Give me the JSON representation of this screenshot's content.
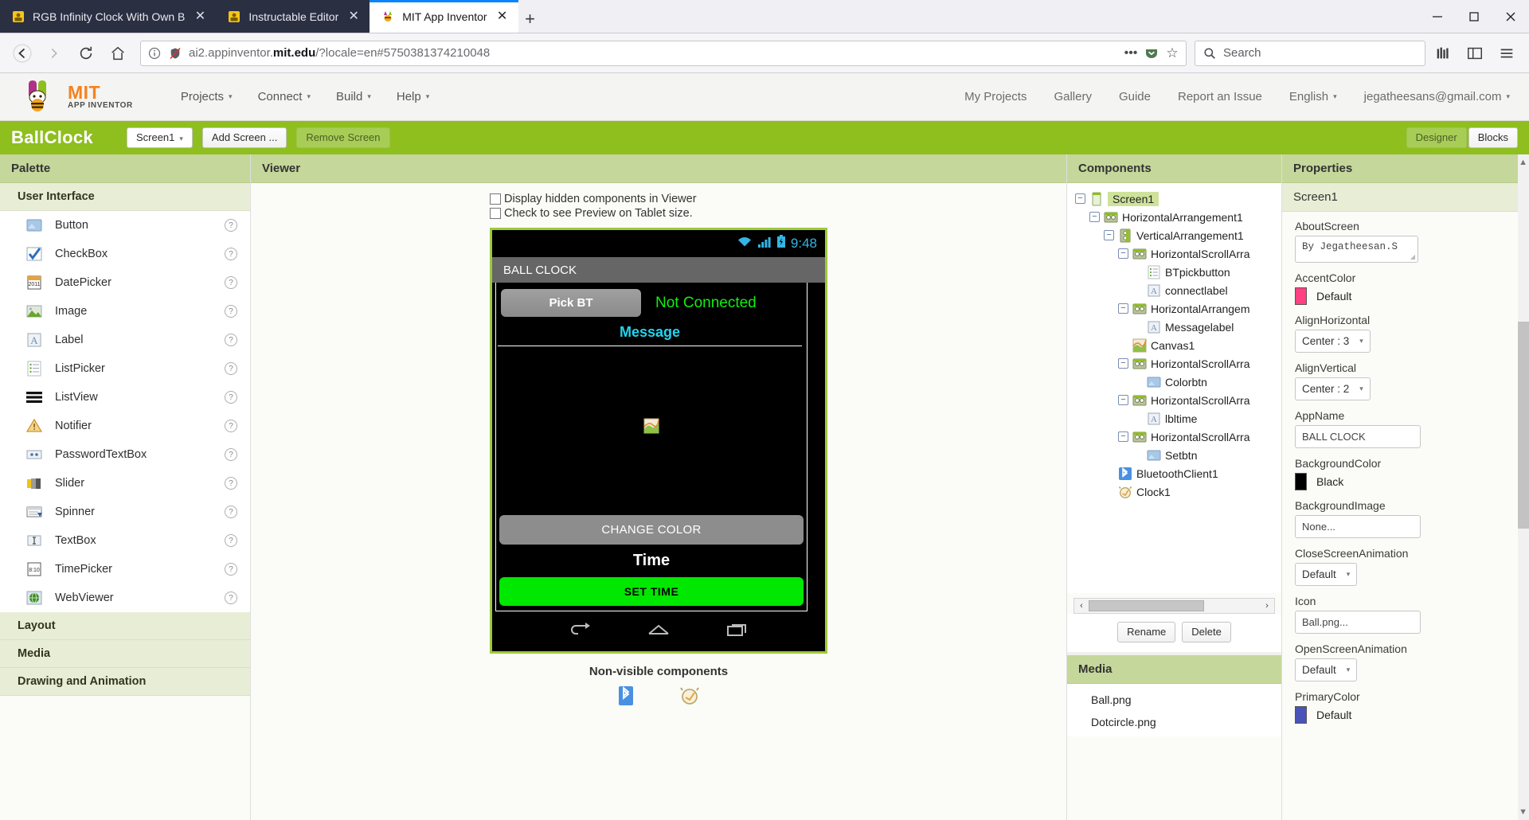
{
  "browser": {
    "tabs": [
      {
        "title": "RGB Infinity Clock With Own B",
        "active": false,
        "favicon": "instructables-icon"
      },
      {
        "title": "Instructable Editor",
        "active": false,
        "favicon": "instructables-icon"
      },
      {
        "title": "MIT App Inventor",
        "active": true,
        "favicon": "app-inventor-icon"
      }
    ],
    "new_tab_label": "+",
    "close_label": "✕",
    "window_minimize": "–",
    "window_maximize": "❐",
    "window_close": "✕",
    "nav": {
      "back": "←",
      "forward": "→",
      "reload": "⟳",
      "home": "⌂"
    },
    "url": {
      "prefix": "ai2.appinventor.",
      "bold": "mit.edu",
      "suffix": "/?locale=en#5750381374210048",
      "info_icon": "info-icon",
      "tracking_icon": "tracking-protection-off-icon",
      "menu_icon": "•••",
      "pocket_icon": "pocket-icon",
      "bookmark_icon": "☆"
    },
    "search": {
      "placeholder": "Search",
      "icon": "search-icon"
    },
    "library_icon": "library-icon",
    "sidebar_icon": "sidebar-icon",
    "menu_icon": "hamburger-menu-icon"
  },
  "mit_header": {
    "logo_line1": "MIT",
    "logo_line2": "APP INVENTOR",
    "menu": [
      {
        "label": "Projects",
        "caret": "▾"
      },
      {
        "label": "Connect",
        "caret": "▾"
      },
      {
        "label": "Build",
        "caret": "▾"
      },
      {
        "label": "Help",
        "caret": "▾"
      }
    ],
    "right_menu": [
      {
        "label": "My Projects",
        "caret": ""
      },
      {
        "label": "Gallery",
        "caret": ""
      },
      {
        "label": "Guide",
        "caret": ""
      },
      {
        "label": "Report an Issue",
        "caret": ""
      },
      {
        "label": "English",
        "caret": "▾"
      },
      {
        "label": "jegatheesans@gmail.com",
        "caret": "▾"
      }
    ]
  },
  "project_bar": {
    "project_name": "BallClock",
    "screen_select": "Screen1",
    "screen_caret": "▾",
    "add_screen": "Add Screen ...",
    "remove_screen": "Remove Screen",
    "designer": "Designer",
    "blocks": "Blocks"
  },
  "palette": {
    "title": "Palette",
    "sections": [
      {
        "name": "User Interface",
        "open": true,
        "items": [
          {
            "label": "Button",
            "icon": "button-icon",
            "help": "?"
          },
          {
            "label": "CheckBox",
            "icon": "checkbox-icon",
            "help": "?"
          },
          {
            "label": "DatePicker",
            "icon": "datepicker-icon",
            "help": "?"
          },
          {
            "label": "Image",
            "icon": "image-icon",
            "help": "?"
          },
          {
            "label": "Label",
            "icon": "label-icon",
            "help": "?"
          },
          {
            "label": "ListPicker",
            "icon": "listpicker-icon",
            "help": "?"
          },
          {
            "label": "ListView",
            "icon": "listview-icon",
            "help": "?"
          },
          {
            "label": "Notifier",
            "icon": "notifier-icon",
            "help": "?"
          },
          {
            "label": "PasswordTextBox",
            "icon": "passwordtextbox-icon",
            "help": "?"
          },
          {
            "label": "Slider",
            "icon": "slider-icon",
            "help": "?"
          },
          {
            "label": "Spinner",
            "icon": "spinner-icon",
            "help": "?"
          },
          {
            "label": "TextBox",
            "icon": "textbox-icon",
            "help": "?"
          },
          {
            "label": "TimePicker",
            "icon": "timepicker-icon",
            "help": "?"
          },
          {
            "label": "WebViewer",
            "icon": "webviewer-icon",
            "help": "?"
          }
        ]
      },
      {
        "name": "Layout",
        "open": false,
        "items": []
      },
      {
        "name": "Media",
        "open": false,
        "items": []
      },
      {
        "name": "Drawing and Animation",
        "open": false,
        "items": []
      }
    ]
  },
  "viewer": {
    "title": "Viewer",
    "checkbox_hidden": "Display hidden components in Viewer",
    "checkbox_tablet": "Check to see Preview on Tablet size.",
    "phone": {
      "status_time": "9:48",
      "status_icons": [
        "wifi-icon",
        "signal-icon",
        "battery-icon"
      ],
      "app_title": "BALL CLOCK",
      "pick_bt": "Pick BT",
      "connect_label": "Not Connected",
      "message_label": "Message",
      "canvas_icon": "canvas-icon",
      "change_color": "CHANGE COLOR",
      "time_label": "Time",
      "set_time": "SET TIME",
      "nav_back": "back-icon",
      "nav_home": "home-icon",
      "nav_recents": "recents-icon"
    },
    "nonvisible_title": "Non-visible components",
    "nonvisible": [
      {
        "label": "BluetoothClient1",
        "icon": "bluetooth-icon"
      },
      {
        "label": "Clock1",
        "icon": "clock-icon"
      }
    ]
  },
  "components": {
    "title": "Components",
    "tree": [
      {
        "label": "Screen1",
        "depth": 0,
        "expander": "−",
        "icon": "screen-icon",
        "selected": true
      },
      {
        "label": "HorizontalArrangement1",
        "depth": 1,
        "expander": "−",
        "icon": "harrangement-icon",
        "selected": false
      },
      {
        "label": "VerticalArrangement1",
        "depth": 2,
        "expander": "−",
        "icon": "varrangement-icon",
        "selected": false
      },
      {
        "label": "HorizontalScrollArra",
        "depth": 3,
        "expander": "−",
        "icon": "harrangement-icon",
        "selected": false
      },
      {
        "label": "BTpickbutton",
        "depth": 4,
        "expander": "",
        "icon": "listpicker-icon",
        "selected": false
      },
      {
        "label": "connectlabel",
        "depth": 4,
        "expander": "",
        "icon": "label-icon",
        "selected": false
      },
      {
        "label": "HorizontalArrangem",
        "depth": 3,
        "expander": "−",
        "icon": "harrangement-icon",
        "selected": false
      },
      {
        "label": "Messagelabel",
        "depth": 4,
        "expander": "",
        "icon": "label-icon",
        "selected": false
      },
      {
        "label": "Canvas1",
        "depth": 3,
        "expander": "",
        "icon": "canvas-icon",
        "selected": false
      },
      {
        "label": "HorizontalScrollArra",
        "depth": 3,
        "expander": "−",
        "icon": "harrangement-icon",
        "selected": false
      },
      {
        "label": "Colorbtn",
        "depth": 4,
        "expander": "",
        "icon": "button-icon",
        "selected": false
      },
      {
        "label": "HorizontalScrollArra",
        "depth": 3,
        "expander": "−",
        "icon": "harrangement-icon",
        "selected": false
      },
      {
        "label": "lbltime",
        "depth": 4,
        "expander": "",
        "icon": "label-icon",
        "selected": false
      },
      {
        "label": "HorizontalScrollArra",
        "depth": 3,
        "expander": "−",
        "icon": "harrangement-icon",
        "selected": false
      },
      {
        "label": "Setbtn",
        "depth": 4,
        "expander": "",
        "icon": "button-icon",
        "selected": false
      },
      {
        "label": "BluetoothClient1",
        "depth": 2,
        "expander": "",
        "icon": "bluetooth-icon",
        "selected": false
      },
      {
        "label": "Clock1",
        "depth": 2,
        "expander": "",
        "icon": "clock-icon",
        "selected": false
      }
    ],
    "scroll_left": "‹",
    "scroll_right": "›",
    "rename": "Rename",
    "delete": "Delete"
  },
  "media": {
    "title": "Media",
    "files": [
      "Ball.png",
      "Dotcircle.png"
    ]
  },
  "properties": {
    "title": "Properties",
    "component": "Screen1",
    "items": [
      {
        "name": "AboutScreen",
        "type": "textarea",
        "value": "By Jegatheesan.S"
      },
      {
        "name": "AccentColor",
        "type": "color",
        "value": "Default",
        "hex": "#ff4081"
      },
      {
        "name": "AlignHorizontal",
        "type": "select",
        "value": "Center : 3",
        "caret": "▾"
      },
      {
        "name": "AlignVertical",
        "type": "select",
        "value": "Center : 2",
        "caret": "▾"
      },
      {
        "name": "AppName",
        "type": "text",
        "value": "BALL CLOCK"
      },
      {
        "name": "BackgroundColor",
        "type": "color",
        "value": "Black",
        "hex": "#000000"
      },
      {
        "name": "BackgroundImage",
        "type": "text",
        "value": "None..."
      },
      {
        "name": "CloseScreenAnimation",
        "type": "select",
        "value": "Default",
        "caret": "▾"
      },
      {
        "name": "Icon",
        "type": "text",
        "value": "Ball.png..."
      },
      {
        "name": "OpenScreenAnimation",
        "type": "select",
        "value": "Default",
        "caret": "▾"
      },
      {
        "name": "PrimaryColor",
        "type": "color",
        "value": "Default",
        "hex": "#4a53b8"
      }
    ]
  }
}
